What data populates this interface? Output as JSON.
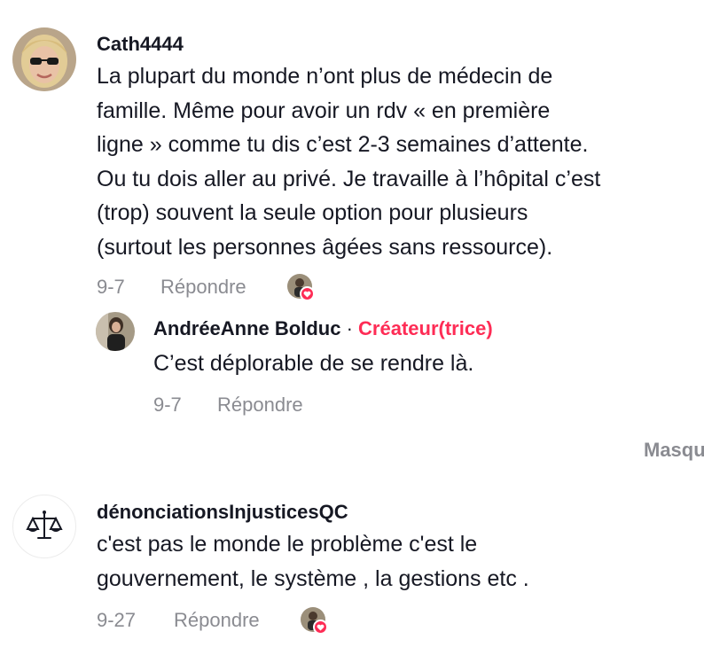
{
  "comments": [
    {
      "username": "Cath4444",
      "text_lines": [
        "La plupart du monde n’ont plus de médecin de",
        "famille. Même pour avoir un rdv « en première",
        "ligne » comme tu dis c’est 2-3 semaines d’attente.",
        "Ou tu dois aller au privé. Je travaille à l’hôpital c’est",
        "(trop) souvent la seule option pour plusieurs",
        "(surtout les personnes âgées sans ressource)."
      ],
      "date": "9-7",
      "reply_label": "Répondre",
      "reply": {
        "username": "AndréeAnne Bolduc",
        "separator": "·",
        "creator_label": "Créateur(trice)",
        "text": "C’est déplorable de se rendre là.",
        "date": "9-7",
        "reply_label": "Répondre"
      }
    },
    {
      "username": "dénonciationsInjusticesQC",
      "text_lines": [
        "c'est pas le monde le problème c'est le",
        "gouvernement, le système , la gestions etc ."
      ],
      "date": "9-27",
      "reply_label": "Répondre"
    }
  ],
  "hide_replies_label": "Masquer",
  "colors": {
    "accent": "#fe2c55",
    "muted": "#8a8b91",
    "text": "#161823"
  }
}
